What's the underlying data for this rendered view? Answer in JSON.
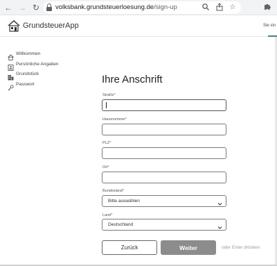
{
  "browser": {
    "url_domain": "volksbank.grundsteuerloesung.de",
    "url_path": "/sign-up",
    "back_icon": "arrow-left-icon",
    "forward_icon": "arrow-right-icon",
    "reload_icon": "reload-icon"
  },
  "header": {
    "brand": "GrundsteuerApp",
    "right_text": "Sie sin"
  },
  "sidebar": {
    "items": [
      {
        "label": "Willkommen",
        "icon": "home-icon"
      },
      {
        "label": "Persönliche Angaben",
        "icon": "id-card-icon"
      },
      {
        "label": "Grundstück",
        "icon": "building-icon"
      },
      {
        "label": "Passwort",
        "icon": "key-icon"
      }
    ]
  },
  "form": {
    "title": "Ihre Anschrift",
    "street_label": "Straße",
    "street_value": "",
    "housenumber_label": "Hausnummer",
    "housenumber_value": "",
    "zip_label": "PLZ",
    "zip_value": "",
    "city_label": "Ort",
    "city_value": "",
    "state_label": "Bundesland",
    "state_value": "Bitte auswählen",
    "country_label": "Land",
    "country_value": "Deutschland",
    "required_marker": "*"
  },
  "actions": {
    "back_label": "Zurück",
    "next_label": "Weiter",
    "enter_hint": "oder Enter drücken"
  },
  "colors": {
    "accent": "#4a7f86",
    "required": "#e0344a",
    "next_button": "#8c8c8c"
  }
}
